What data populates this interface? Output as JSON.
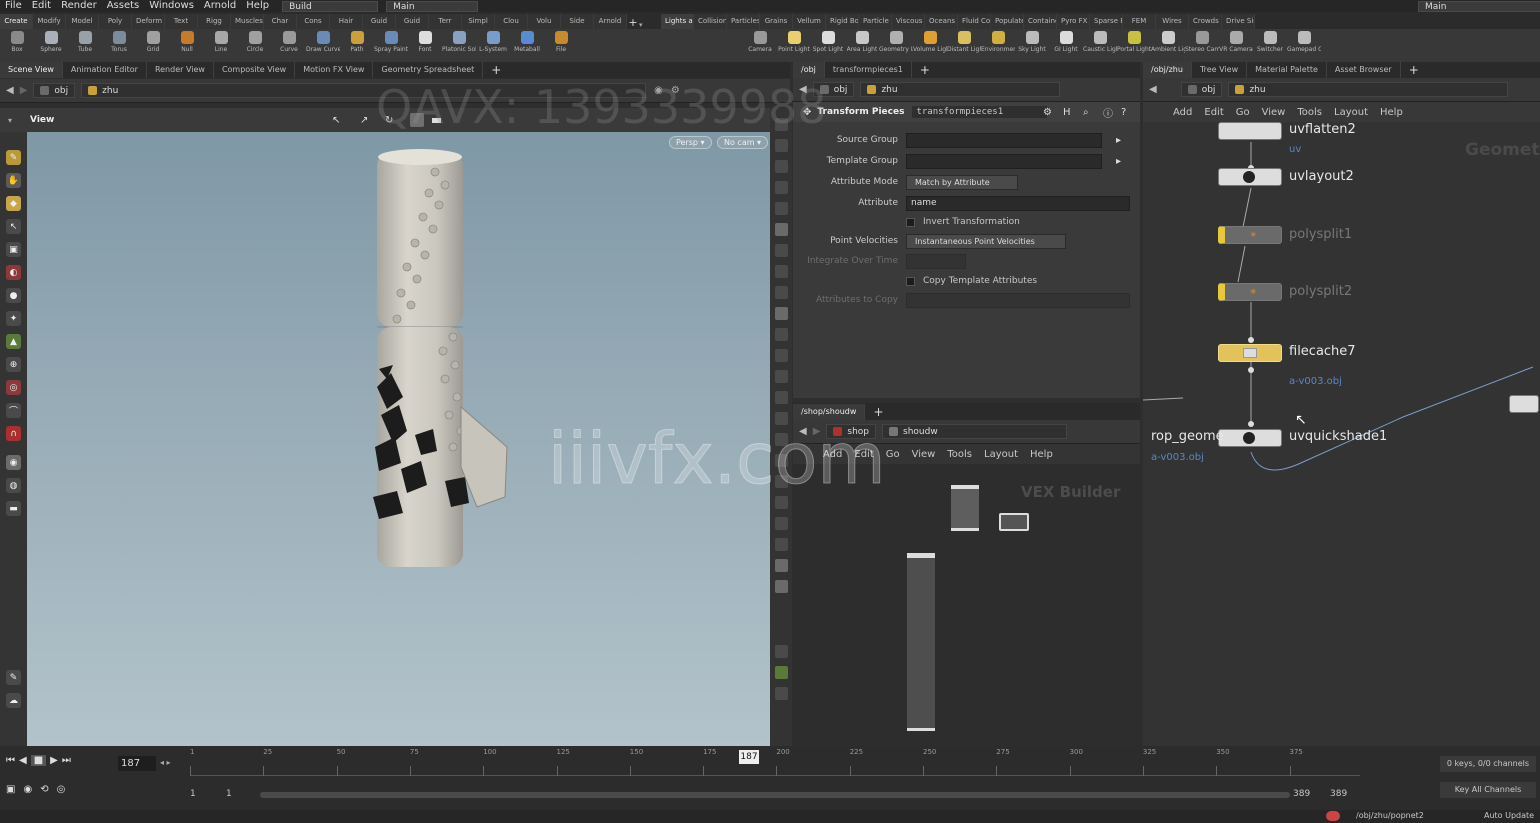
{
  "menu": [
    "File",
    "Edit",
    "Render",
    "Assets",
    "Windows",
    "Arnold",
    "Help"
  ],
  "desktop": {
    "build": "Build",
    "main": "Main",
    "main_right": "Main"
  },
  "shelf_tabs_left": [
    "Create",
    "Modify",
    "Model",
    "Poly",
    "Deform",
    "Text",
    "Rigg",
    "Muscles",
    "Char",
    "Cons",
    "Hair",
    "Guid",
    "Guid",
    "Terr",
    "Simpl",
    "Clou",
    "Volu",
    "Side",
    "Arnold"
  ],
  "shelf_tabs_right": [
    "Lights and",
    "Collisions",
    "Particles",
    "Grains",
    "Vellum",
    "Rigid Bodies",
    "Particle Fl",
    "Viscous Fl",
    "Oceans",
    "Fluid Con",
    "Populate C",
    "Container",
    "Pyro FX",
    "Sparse Pyr",
    "FEM",
    "Wires",
    "Crowds",
    "Drive Sim"
  ],
  "shelf_tools_left": [
    "Box",
    "Sphere",
    "Tube",
    "Torus",
    "Grid",
    "Null",
    "Line",
    "Circle",
    "Curve",
    "Draw Curve",
    "Path",
    "Spray Paint",
    "Font",
    "Platonic Solids",
    "L-System",
    "Metaball",
    "File"
  ],
  "shelf_tools_right": [
    "Camera",
    "Point Light",
    "Spot Light",
    "Area Light",
    "Geometry Light",
    "Volume Light",
    "Distant Light",
    "Environment Light",
    "Sky Light",
    "GI Light",
    "Caustic Light",
    "Portal Light",
    "Ambient Light",
    "Stereo Camera",
    "VR Camera",
    "Switcher",
    "Gamepad Camera"
  ],
  "view_tabs": [
    "Scene View",
    "Animation Editor",
    "Render View",
    "Composite View",
    "Motion FX View",
    "Geometry Spreadsheet"
  ],
  "viewer": {
    "path_obj": "obj",
    "path_geo": "zhu",
    "label": "View",
    "persp": "Persp ▾",
    "cam": "No cam ▾"
  },
  "param_tabs": {
    "path": "/obj",
    "node": "transformpieces1"
  },
  "params": {
    "path_obj": "obj",
    "path_geo": "zhu",
    "node_type": "Transform Pieces",
    "node_name": "transformpieces1",
    "source_group_label": "Source Group",
    "template_group_label": "Template Group",
    "attribute_mode_label": "Attribute Mode",
    "attribute_mode_value": "Match by Attribute",
    "attribute_label": "Attribute",
    "attribute_value": "name",
    "invert_label": "Invert Transformation",
    "point_vel_label": "Point Velocities",
    "point_vel_value": "Instantaneous Point Velocities",
    "integrate_label": "Integrate Over Time",
    "copy_template_label": "Copy Template Attributes",
    "attrs_copy_label": "Attributes to Copy"
  },
  "shop": {
    "tab": "/shop/shoudw",
    "path_shop": "shop",
    "path_node": "shoudw",
    "menu": [
      "Add",
      "Edit",
      "Go",
      "View",
      "Tools",
      "Layout",
      "Help"
    ],
    "builder_label": "VEX Builder"
  },
  "network": {
    "path": "/obj/zhu",
    "tabs": [
      "Tree View",
      "Material Palette",
      "Asset Browser"
    ],
    "path_obj": "obj",
    "path_geo": "zhu",
    "menu": [
      "Add",
      "Edit",
      "Go",
      "View",
      "Tools",
      "Layout",
      "Help"
    ],
    "context_label": "Geometry",
    "nodes": [
      {
        "name": "uvflatten2",
        "sub": "uv"
      },
      {
        "name": "uvlayout2",
        "sub": ""
      },
      {
        "name": "polysplit1",
        "sub": ""
      },
      {
        "name": "polysplit2",
        "sub": ""
      },
      {
        "name": "filecache7",
        "sub": "a-v003.obj"
      },
      {
        "name": "uvquickshade1",
        "sub": ""
      },
      {
        "name": "rop_geome",
        "sub": "a-v003.obj"
      }
    ]
  },
  "timeline": {
    "current_frame": "187",
    "ticks": [
      "1",
      "25",
      "50",
      "75",
      "100",
      "125",
      "150",
      "175",
      "200",
      "225",
      "250",
      "275",
      "300",
      "325",
      "350",
      "375"
    ],
    "range_start": "1",
    "range_start2": "1",
    "range_end": "389",
    "range_end2": "389",
    "keys_info": "0 keys, 0/0 channels",
    "key_all": "Key All Channels"
  },
  "status": {
    "path": "/obj/zhu/popnet2",
    "auto_update": "Auto Update"
  },
  "watermarks": {
    "top": "QAVX: 1393339988",
    "center": "iiivfx.com"
  }
}
